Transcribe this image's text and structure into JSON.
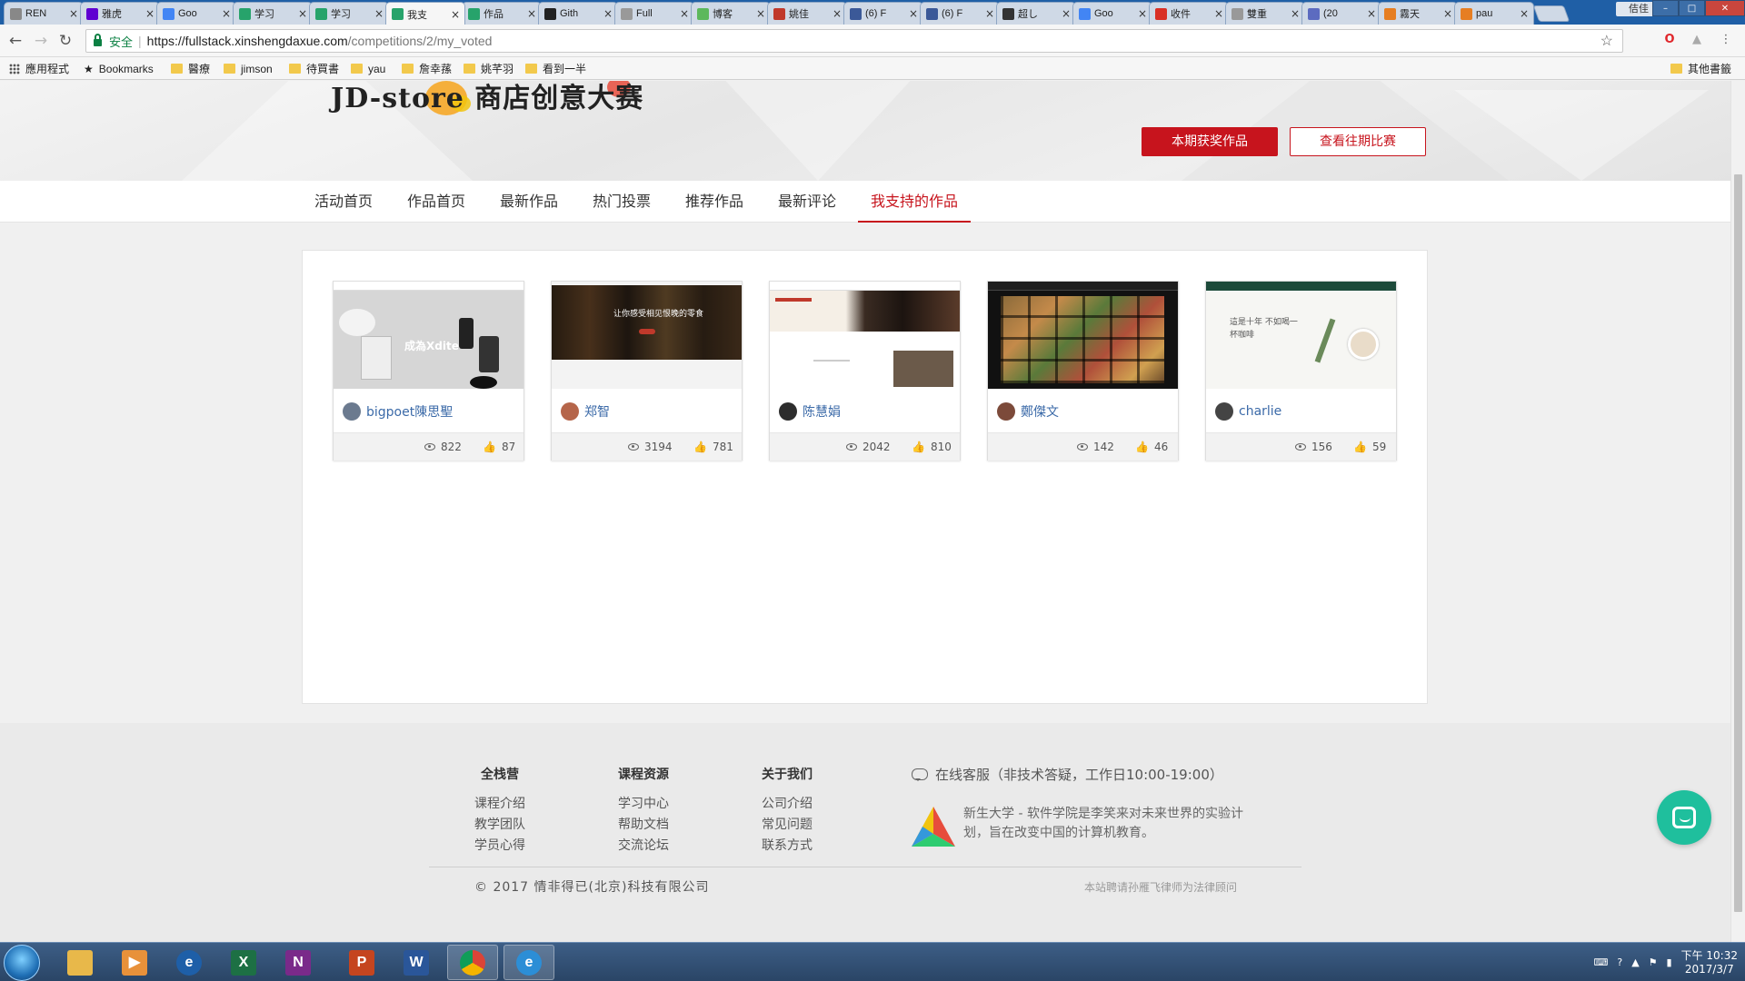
{
  "browser": {
    "tabs": [
      {
        "title": "REN",
        "fav": "#888"
      },
      {
        "title": "雅虎",
        "fav": "#5f01d1"
      },
      {
        "title": "Goo",
        "fav": "#4285f4"
      },
      {
        "title": "学习",
        "fav": "#27a36b"
      },
      {
        "title": "学习",
        "fav": "#27a36b"
      },
      {
        "title": "我支",
        "fav": "#27a36b"
      },
      {
        "title": "作品",
        "fav": "#27a36b"
      },
      {
        "title": "Gith",
        "fav": "#222"
      },
      {
        "title": "Full",
        "fav": "#999"
      },
      {
        "title": "博客",
        "fav": "#5cb85c"
      },
      {
        "title": "姚佳",
        "fav": "#c0392b"
      },
      {
        "title": "(6) F",
        "fav": "#3b5998"
      },
      {
        "title": "(6) F",
        "fav": "#3b5998"
      },
      {
        "title": "超し",
        "fav": "#333"
      },
      {
        "title": "Goo",
        "fav": "#4285f4"
      },
      {
        "title": "收件",
        "fav": "#d93025"
      },
      {
        "title": "雙重",
        "fav": "#999"
      },
      {
        "title": "(20",
        "fav": "#5c6bc0"
      },
      {
        "title": "霧天",
        "fav": "#e67e22"
      },
      {
        "title": "pau",
        "fav": "#e67e22"
      }
    ],
    "user_button": "佶佳",
    "secure_label": "安全",
    "url_host": "https://fullstack.xinshengdaxue.com",
    "url_path": "/competitions/2/my_voted",
    "bookmarks": [
      "應用程式",
      "Bookmarks",
      "醫療",
      "jimson",
      "待買書",
      "yau",
      "詹幸蓀",
      "姚芊羽",
      "看到一半"
    ],
    "other_bookmarks": "其他書籤"
  },
  "hero": {
    "logo_text": "JD-store 商店创意大赛",
    "award_button": "本期获奖作品",
    "past_button": "查看往期比赛"
  },
  "nav": {
    "items": [
      "活动首页",
      "作品首页",
      "最新作品",
      "热门投票",
      "推荐作品",
      "最新评论",
      "我支持的作品"
    ],
    "active_index": 6
  },
  "cards": [
    {
      "author": "bigpoet陳思聖",
      "views": "822",
      "likes": "87",
      "thumb_caption": "成為Xdite",
      "avatar_color": "#6b7a8f"
    },
    {
      "author": "郑智",
      "views": "3194",
      "likes": "781",
      "thumb_caption": "让你感受相见恨晚的零食",
      "avatar_color": "#b5654a"
    },
    {
      "author": "陈慧娟",
      "views": "2042",
      "likes": "810",
      "thumb_caption": "",
      "avatar_color": "#2d2d2d"
    },
    {
      "author": "鄭傑文",
      "views": "142",
      "likes": "46",
      "thumb_caption": "",
      "avatar_color": "#7c4a3a"
    },
    {
      "author": "charlie",
      "views": "156",
      "likes": "59",
      "thumb_caption": "這是十年 不如喝一杯咖啡",
      "avatar_color": "#444"
    }
  ],
  "footer": {
    "columns": [
      {
        "heading": "全栈营",
        "links": [
          "课程介绍",
          "教学团队",
          "学员心得"
        ]
      },
      {
        "heading": "课程资源",
        "links": [
          "学习中心",
          "帮助文档",
          "交流论坛"
        ]
      },
      {
        "heading": "关于我们",
        "links": [
          "公司介绍",
          "常见问题",
          "联系方式"
        ]
      }
    ],
    "service": "在线客服（非技术答疑，工作日10:00-19:00）",
    "description": "新生大学 - 软件学院是李笑来对未来世界的实验计划，旨在改变中国的计算机教育。",
    "copyright": "© 2017 情非得已(北京)科技有限公司",
    "legal": "本站聘请孙雁飞律师为法律顾问"
  },
  "taskbar": {
    "time": "下午 10:32",
    "date": "2017/3/7"
  },
  "colors": {
    "accent": "#c7141d",
    "link": "#3b6aa8",
    "chat": "#1fbf9d"
  }
}
